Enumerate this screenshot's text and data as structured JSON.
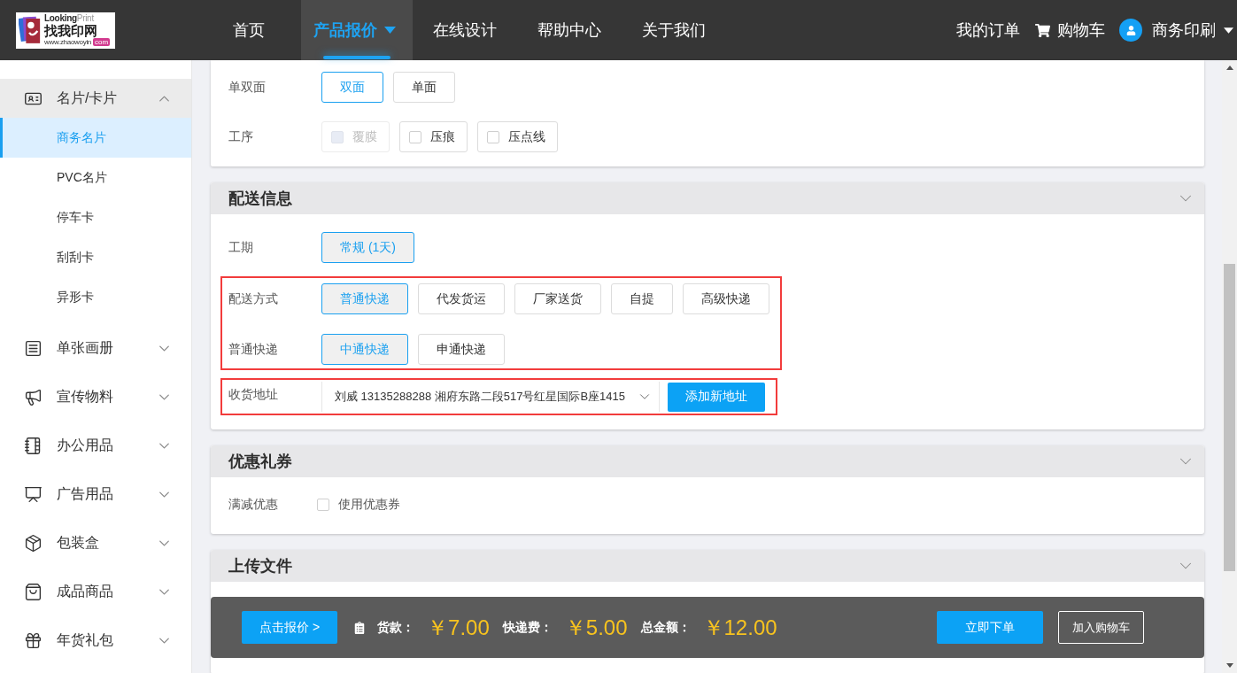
{
  "header": {
    "logo": {
      "wordmark_a": "Looking",
      "wordmark_b": "Print",
      "name": "找我印网",
      "url": "www.zhaowoyin",
      "url_badge": "com"
    },
    "nav": [
      {
        "label": "首页",
        "selected": false,
        "dropdown": false
      },
      {
        "label": "产品报价",
        "selected": true,
        "dropdown": true
      },
      {
        "label": "在线设计",
        "selected": false,
        "dropdown": false
      },
      {
        "label": "帮助中心",
        "selected": false,
        "dropdown": false
      },
      {
        "label": "关于我们",
        "selected": false,
        "dropdown": false
      }
    ],
    "orders": "我的订单",
    "cart": "购物车",
    "user": "商务印刷"
  },
  "sidebar": {
    "groups": [
      {
        "label": "名片/卡片",
        "expanded": true,
        "children": [
          {
            "label": "商务名片",
            "selected": true
          },
          {
            "label": "PVC名片",
            "selected": false
          },
          {
            "label": "停车卡",
            "selected": false
          },
          {
            "label": "刮刮卡",
            "selected": false
          },
          {
            "label": "异形卡",
            "selected": false
          }
        ]
      },
      {
        "label": "单张画册",
        "expanded": false
      },
      {
        "label": "宣传物料",
        "expanded": false
      },
      {
        "label": "办公用品",
        "expanded": false
      },
      {
        "label": "广告用品",
        "expanded": false
      },
      {
        "label": "包装盒",
        "expanded": false
      },
      {
        "label": "成品商品",
        "expanded": false
      },
      {
        "label": "年货礼包",
        "expanded": false
      }
    ]
  },
  "spec_card": {
    "rows": [
      {
        "label": "单双面",
        "kind": "buttons",
        "options": [
          {
            "label": "双面",
            "selected": true
          },
          {
            "label": "单面",
            "selected": false
          }
        ]
      },
      {
        "label": "工序",
        "kind": "check_buttons",
        "options": [
          {
            "label": "覆膜",
            "checked": false,
            "disabled": true
          },
          {
            "label": "压痕",
            "checked": false,
            "disabled": false
          },
          {
            "label": "压点线",
            "checked": false,
            "disabled": false
          }
        ]
      }
    ]
  },
  "sections": [
    {
      "title": "配送信息",
      "groups": [
        {
          "highlighted": false,
          "rows": [
            {
              "label": "工期",
              "kind": "buttons",
              "options": [
                {
                  "label": "常规 (1天)",
                  "selected": true
                }
              ]
            }
          ]
        },
        {
          "highlighted": true,
          "rows": [
            {
              "label": "配送方式",
              "kind": "buttons",
              "options": [
                {
                  "label": "普通快递",
                  "selected": true
                },
                {
                  "label": "代发货运",
                  "selected": false
                },
                {
                  "label": "厂家送货",
                  "selected": false
                },
                {
                  "label": "自提",
                  "selected": false
                },
                {
                  "label": "高级快递",
                  "selected": false
                }
              ]
            },
            {
              "label": "普通快递",
              "kind": "buttons",
              "options": [
                {
                  "label": "中通快递",
                  "selected": true
                },
                {
                  "label": "申通快递",
                  "selected": false
                }
              ]
            }
          ]
        },
        {
          "highlighted": true,
          "rows": [
            {
              "label": "收货地址",
              "kind": "address",
              "value": "刘威 13135288288 湘府东路二段517号红星国际B座1415",
              "button": "添加新地址"
            }
          ]
        }
      ]
    },
    {
      "title": "优惠礼券",
      "groups": [
        {
          "highlighted": false,
          "rows": [
            {
              "label": "满减优惠",
              "kind": "checkbox",
              "options": [
                {
                  "label": "使用优惠券",
                  "checked": false
                }
              ]
            }
          ]
        }
      ]
    },
    {
      "title": "上传文件"
    }
  ],
  "bottom_bar": {
    "quote_button": "点击报价 >",
    "items": [
      {
        "label": "货款：",
        "amount": "￥7.00"
      },
      {
        "label": "快递费：",
        "amount": "￥5.00"
      },
      {
        "label": "总金额：",
        "amount": "￥12.00"
      }
    ],
    "order_button": "立即下单",
    "cart_button": "加入购物车"
  }
}
